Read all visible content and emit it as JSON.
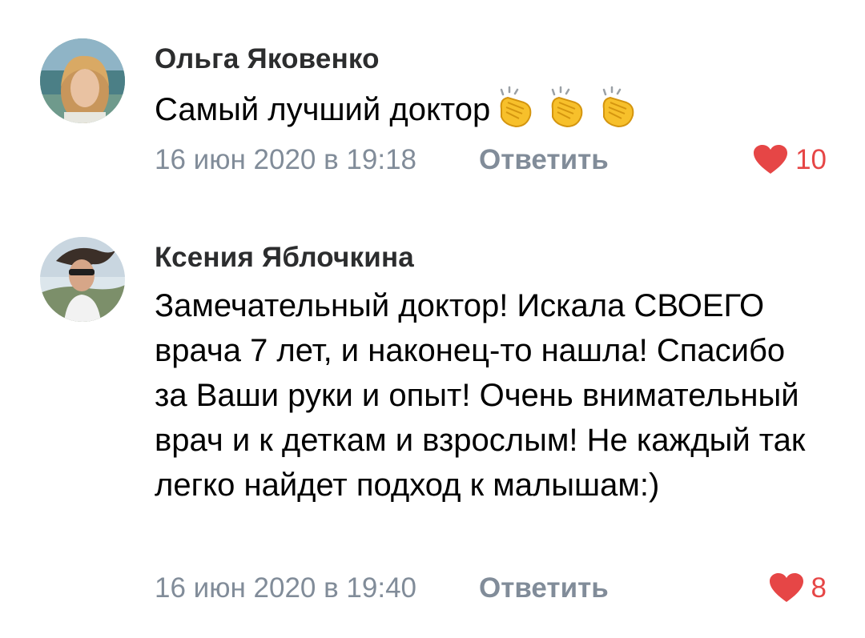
{
  "comments": [
    {
      "author": "Ольга Яковенко",
      "text": "Самый лучший доктор",
      "emoji": [
        "clap-icon",
        "clap-icon",
        "clap-icon"
      ],
      "date": "16 июн 2020 в 19:18",
      "reply_label": "Ответить",
      "likes": "10"
    },
    {
      "author": "Ксения Яблочкина",
      "text": "Замечательный доктор! Искала СВОЕГО врача 7 лет, и наконец-то нашла! Спасибо за Ваши руки и опыт! Очень внимательный врач и к деткам и взрослым! Не каждый так легко найдет подход к малышам:)",
      "date": "16 июн 2020 в 19:40",
      "reply_label": "Ответить",
      "likes": "8"
    }
  ],
  "colors": {
    "like_accent": "#e64646",
    "meta_text": "#818c99",
    "author_text": "#2c2d2e"
  }
}
